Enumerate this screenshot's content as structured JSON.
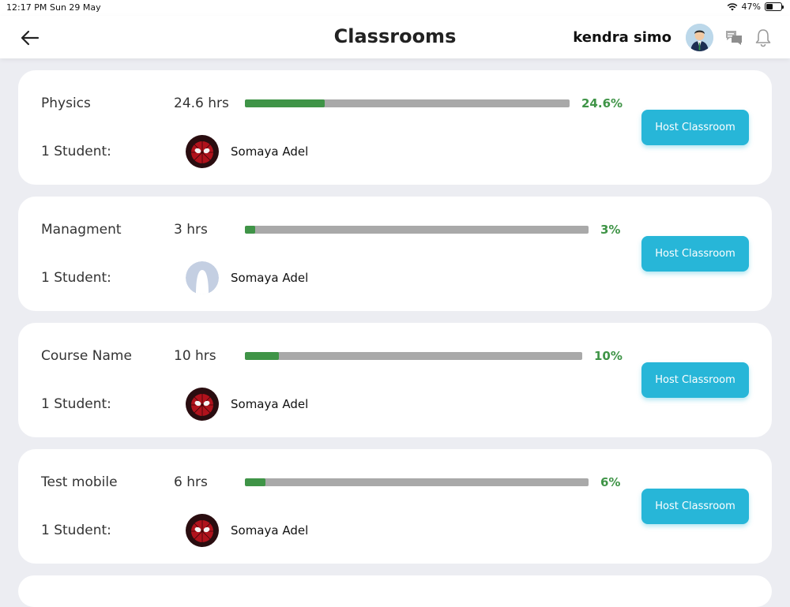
{
  "status_bar": {
    "time": "12:17 PM",
    "date": "Sun 29 May",
    "battery": "47%"
  },
  "header": {
    "title": "Classrooms",
    "username": "kendra simo"
  },
  "icons": {
    "back": "back-arrow-icon",
    "chat": "chat-bubbles-icon",
    "bell": "bell-icon"
  },
  "colors": {
    "accent": "#27b6d8",
    "progress": "#3f9447",
    "track": "#a9a9a9",
    "background": "#ecedf2"
  },
  "classrooms": [
    {
      "name": "Physics",
      "hours": "24.6 hrs",
      "percent_label": "24.6%",
      "progress": 0.246,
      "students_label": "1 Student:",
      "student_name": "Somaya Adel",
      "avatar": "spiderman",
      "button": "Host Classroom"
    },
    {
      "name": "Managment",
      "hours": "3 hrs",
      "percent_label": "3%",
      "progress": 0.03,
      "students_label": "1 Student:",
      "student_name": "Somaya Adel",
      "avatar": "placeholder",
      "button": "Host Classroom"
    },
    {
      "name": "Course Name",
      "hours": "10 hrs",
      "percent_label": "10%",
      "progress": 0.1,
      "students_label": "1 Student:",
      "student_name": "Somaya Adel",
      "avatar": "spiderman",
      "button": "Host Classroom"
    },
    {
      "name": "Test mobile",
      "hours": "6 hrs",
      "percent_label": "6%",
      "progress": 0.06,
      "students_label": "1 Student:",
      "student_name": "Somaya Adel",
      "avatar": "spiderman",
      "button": "Host Classroom"
    }
  ]
}
